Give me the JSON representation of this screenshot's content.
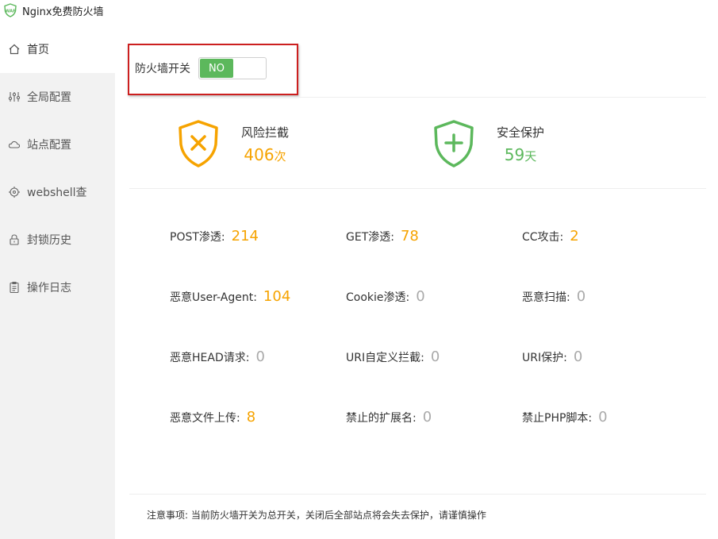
{
  "app": {
    "title": "Nginx免费防火墙",
    "logo_text": "WAF"
  },
  "sidebar": {
    "items": [
      {
        "label": "首页",
        "icon": "home-icon",
        "active": true
      },
      {
        "label": "全局配置",
        "icon": "sliders-icon"
      },
      {
        "label": "站点配置",
        "icon": "cloud-icon"
      },
      {
        "label": "webshell查",
        "icon": "target-icon"
      },
      {
        "label": "封锁历史",
        "icon": "lock-icon"
      },
      {
        "label": "操作日志",
        "icon": "clipboard-icon"
      }
    ]
  },
  "firewall": {
    "label": "防火墙开关",
    "state": "NO"
  },
  "stats": {
    "risk": {
      "title": "风险拦截",
      "value": "406",
      "unit": "次",
      "color": "#f6a300"
    },
    "safe": {
      "title": "安全保护",
      "value": "59",
      "unit": "天",
      "color": "#5cb85c"
    }
  },
  "metrics": [
    {
      "label": "POST渗透:",
      "value": "214"
    },
    {
      "label": "GET渗透:",
      "value": "78"
    },
    {
      "label": "CC攻击:",
      "value": "2"
    },
    {
      "label": "恶意User-Agent:",
      "value": "104"
    },
    {
      "label": "Cookie渗透:",
      "value": "0"
    },
    {
      "label": "恶意扫描:",
      "value": "0"
    },
    {
      "label": "恶意HEAD请求:",
      "value": "0"
    },
    {
      "label": "URI自定义拦截:",
      "value": "0"
    },
    {
      "label": "URI保护:",
      "value": "0"
    },
    {
      "label": "恶意文件上传:",
      "value": "8"
    },
    {
      "label": "禁止的扩展名:",
      "value": "0"
    },
    {
      "label": "禁止PHP脚本:",
      "value": "0"
    }
  ],
  "note": "注意事项: 当前防火墙开关为总开关，关闭后全部站点将会失去保护，请谨慎操作"
}
